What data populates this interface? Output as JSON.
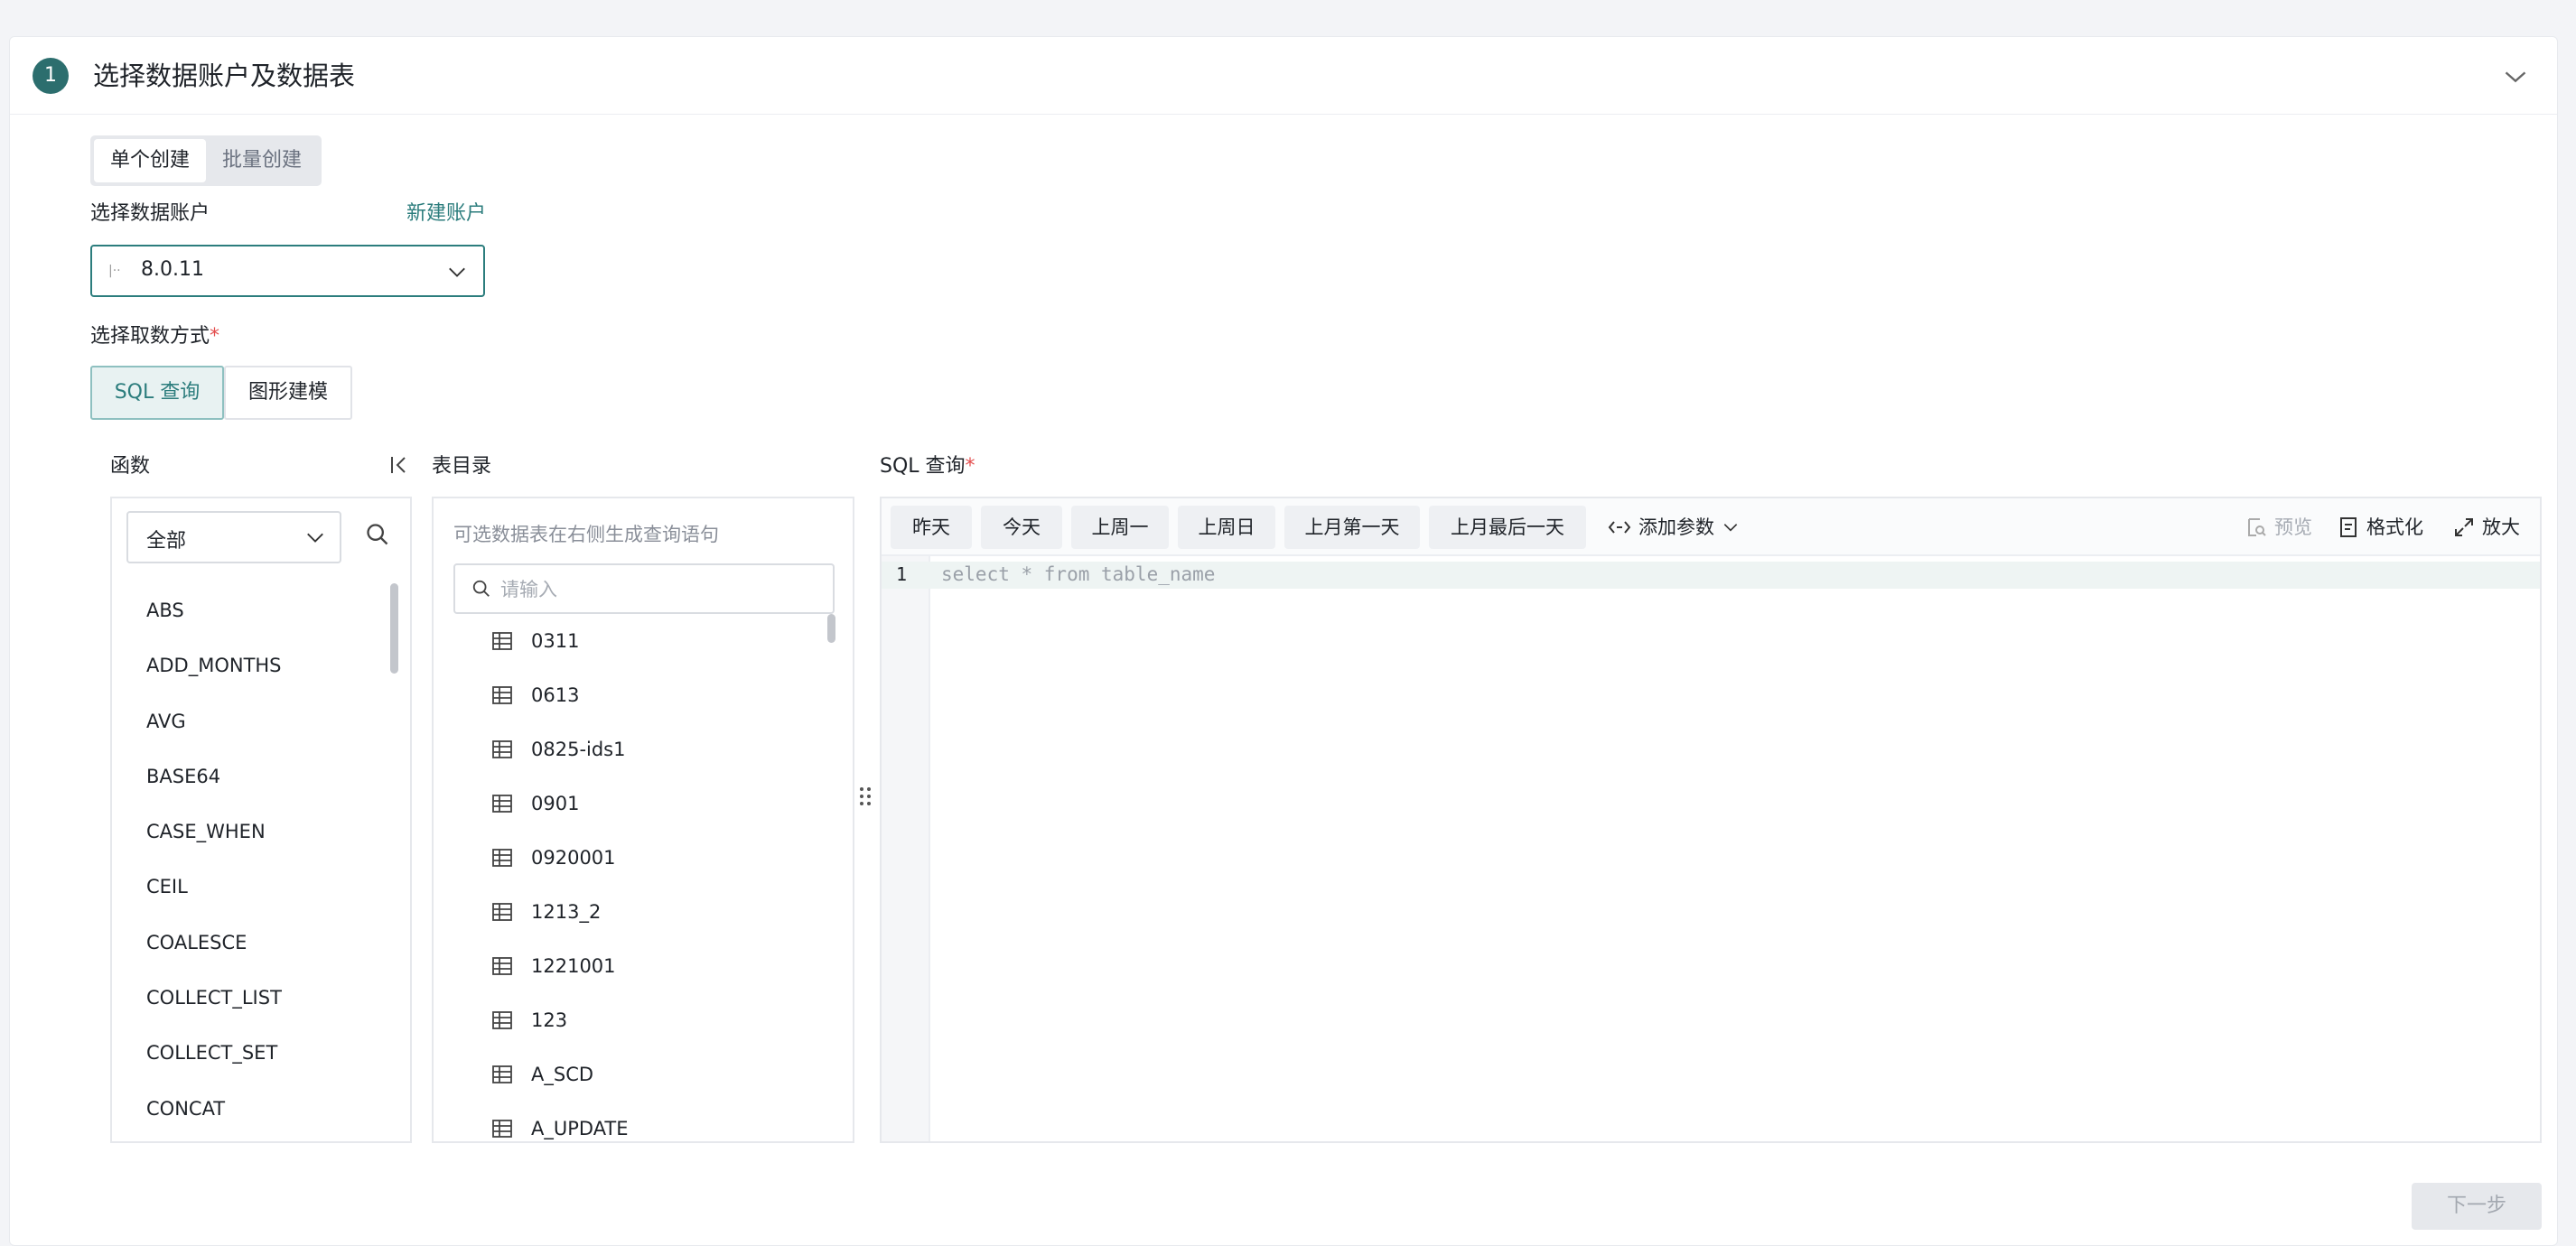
{
  "header": {
    "step_number": "1",
    "title": "选择数据账户及数据表"
  },
  "create_mode": {
    "single": "单个创建",
    "batch": "批量创建"
  },
  "account": {
    "label": "选择数据账户",
    "new_link": "新建账户",
    "selected_value": "8.0.11"
  },
  "method": {
    "label": "选择取数方式",
    "required_mark": "*",
    "sql_tab": "SQL 查询",
    "graph_tab": "图形建模"
  },
  "functions": {
    "title": "函数",
    "filter_value": "全部",
    "items": [
      "ABS",
      "ADD_MONTHS",
      "AVG",
      "BASE64",
      "CASE_WHEN",
      "CEIL",
      "COALESCE",
      "COLLECT_LIST",
      "COLLECT_SET",
      "CONCAT"
    ]
  },
  "tables": {
    "title": "表目录",
    "hint": "可选数据表在右侧生成查询语句",
    "search_placeholder": "请输入",
    "items": [
      "0311",
      "0613",
      "0825-ids1",
      "0901",
      "0920001",
      "1213_2",
      "1221001",
      "123",
      "A_SCD",
      "A_UPDATE"
    ]
  },
  "sql": {
    "title": "SQL 查询",
    "required_mark": "*",
    "chips": [
      "昨天",
      "今天",
      "上周一",
      "上周日",
      "上月第一天",
      "上月最后一天"
    ],
    "add_param": "添加参数",
    "preview": "预览",
    "format": "格式化",
    "expand": "放大",
    "line_number": "1",
    "code": "select * from table_name"
  },
  "footer": {
    "next": "下一步"
  },
  "colors": {
    "accent": "#2c7d7d",
    "badge": "#2c6e6e",
    "required": "#e34d4d"
  }
}
